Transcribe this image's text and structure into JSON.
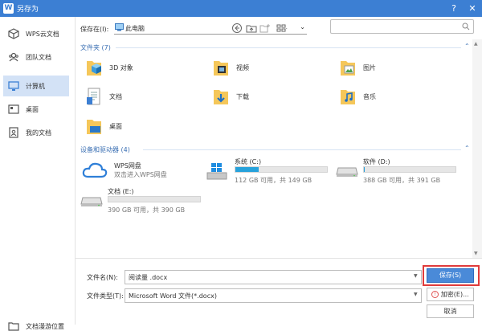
{
  "window": {
    "title": "另存为",
    "logo": "W"
  },
  "colors": {
    "accent": "#3c7fd3",
    "drive_fill": "#27a2db",
    "highlight": "#e03b3b"
  },
  "sidebar": {
    "items": [
      {
        "label": "WPS云文档",
        "icon": "cloud-doc-icon"
      },
      {
        "label": "团队文档",
        "icon": "team-doc-icon"
      },
      {
        "label": "计算机",
        "icon": "computer-icon",
        "active": true
      },
      {
        "label": "桌面",
        "icon": "desktop-icon"
      },
      {
        "label": "我的文档",
        "icon": "my-documents-icon"
      }
    ],
    "add_location": "文档漫游位置"
  },
  "toolbar": {
    "save_in_label": "保存在(I):",
    "location": "此电脑"
  },
  "search": {
    "placeholder": ""
  },
  "groups": {
    "folders_header": "文件夹 (7)",
    "devices_header": "设备和驱动器 (4)"
  },
  "folders": [
    {
      "name": "3D 对象",
      "icon": "3d-objects-icon"
    },
    {
      "name": "视频",
      "icon": "videos-folder-icon"
    },
    {
      "name": "图片",
      "icon": "pictures-folder-icon"
    },
    {
      "name": "文档",
      "icon": "documents-folder-icon"
    },
    {
      "name": "下载",
      "icon": "downloads-folder-icon"
    },
    {
      "name": "音乐",
      "icon": "music-folder-icon"
    },
    {
      "name": "桌面",
      "icon": "desktop-folder-icon"
    }
  ],
  "drives": {
    "wps": {
      "name": "WPS网盘",
      "sub": "双击进入WPS网盘"
    },
    "c": {
      "name": "系统 (C:)",
      "size": "112 GB 可用，共 149 GB",
      "used": 0.25
    },
    "d": {
      "name": "软件 (D:)",
      "size": "388 GB 可用，共 391 GB",
      "used": 0.01
    },
    "e": {
      "name": "文档 (E:)",
      "size": "390 GB 可用，共 390 GB",
      "used": 0.0
    }
  },
  "bottom": {
    "filename_label": "文件名(N):",
    "filename_value": "阅读量 .docx",
    "filetype_label": "文件类型(T):",
    "filetype_value": "Microsoft Word 文件(*.docx)",
    "save_label": "保存(S)",
    "encrypt_label": "加密(E)...",
    "cancel_label": "取消"
  }
}
